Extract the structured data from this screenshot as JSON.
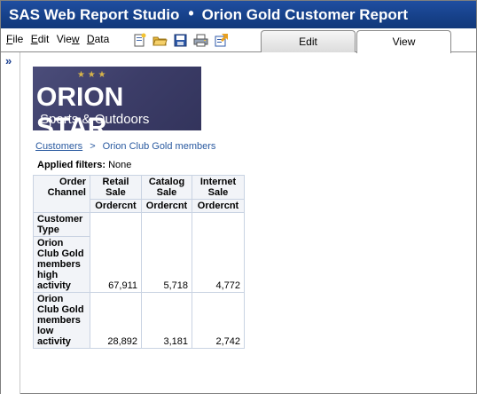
{
  "titlebar": {
    "app": "SAS Web Report Studio",
    "separator": "•",
    "report": "Orion Gold Customer Report"
  },
  "menu": [
    {
      "label": "File",
      "key": "F"
    },
    {
      "label": "Edit",
      "key": "E"
    },
    {
      "label": "View",
      "key": "V"
    },
    {
      "label": "Data",
      "key": "D"
    }
  ],
  "toolbar_icons": [
    "new-report-icon",
    "open-folder-icon",
    "save-icon",
    "print-icon",
    "export-icon"
  ],
  "tabs": {
    "edit": "Edit",
    "view": "View",
    "active": "View"
  },
  "expand_glyph": "»",
  "logo": {
    "line1": "ORION STAR",
    "line2": "Sports & Outdoors",
    "stars": "★ ★ ★"
  },
  "breadcrumb": {
    "first": "Customers",
    "sep": ">",
    "second": "Orion Club Gold members"
  },
  "filters": {
    "label": "Applied filters:",
    "value": "None"
  },
  "table": {
    "corner_line1": "Order",
    "corner_line2": "Channel",
    "columns": [
      {
        "line1": "Retail",
        "line2": "Sale",
        "measure": "Ordercnt"
      },
      {
        "line1": "Catalog",
        "line2": "Sale",
        "measure": "Ordercnt"
      },
      {
        "line1": "Internet",
        "line2": "Sale",
        "measure": "Ordercnt"
      }
    ],
    "row_header_label": [
      "Customer",
      "Type"
    ],
    "rows": [
      {
        "label": [
          "Orion",
          "Club Gold",
          "members",
          "high",
          "activity"
        ],
        "values": [
          "67,911",
          "5,718",
          "4,772"
        ]
      },
      {
        "label": [
          "Orion",
          "Club Gold",
          "members",
          "low",
          "activity"
        ],
        "values": [
          "28,892",
          "3,181",
          "2,742"
        ]
      }
    ]
  },
  "colors": {
    "title_bg": "#164088",
    "link": "#2a5aa0",
    "grid_border": "#8ea2c0"
  }
}
